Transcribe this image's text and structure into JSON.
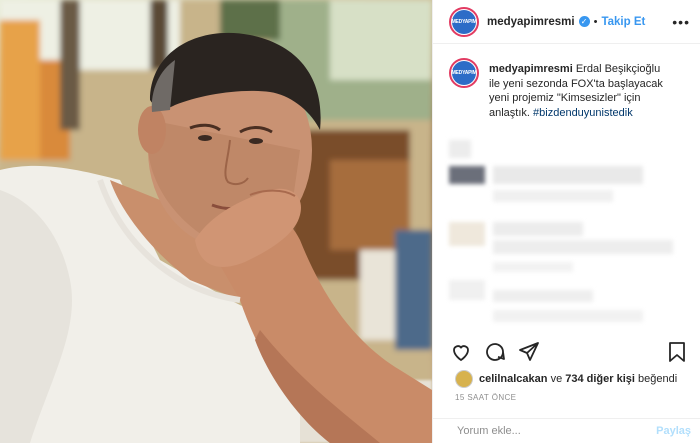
{
  "post": {
    "username": "medyapimresmi",
    "verified_icon": "check-icon",
    "separator": "•",
    "follow_label": "Takip Et",
    "more_label": "•••",
    "avatar_text": "MEDYAPIM"
  },
  "caption": {
    "username": "medyapimresmi",
    "text": "Erdal Beşikçioğlu ile yeni sezonda FOX'ta başlayacak yeni projemiz \"Kimsesizler\" için anlaştık.",
    "hashtag": "#bizdenduyunistedik"
  },
  "actions": {
    "icons": [
      "heart-icon",
      "comment-icon",
      "share-icon",
      "bookmark-icon"
    ]
  },
  "likes": {
    "user": "celilnalcakan",
    "connector": "ve",
    "count_text": "734 diğer kişi",
    "suffix": "beğendi"
  },
  "timestamp": "15 SAAT ÖNCE",
  "comment_box": {
    "placeholder": "Yorum ekle...",
    "post_label": "Paylaş"
  },
  "colors": {
    "accent": "#3897f0",
    "hashtag": "#00376b",
    "ring": "#e23b62"
  }
}
